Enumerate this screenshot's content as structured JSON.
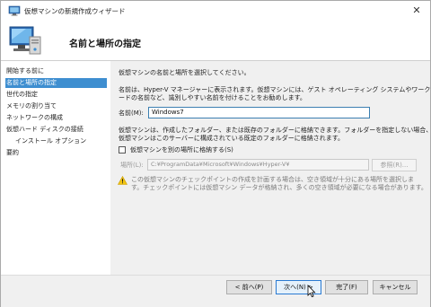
{
  "window": {
    "title": "仮想マシンの新規作成ウィザード",
    "close_glyph": "✕"
  },
  "header": {
    "title": "名前と場所の指定"
  },
  "sidebar": {
    "items": [
      {
        "label": "開始する前に"
      },
      {
        "label": "名前と場所の指定",
        "active": true
      },
      {
        "label": "世代の指定"
      },
      {
        "label": "メモリの割り当て"
      },
      {
        "label": "ネットワークの構成"
      },
      {
        "label": "仮想ハード ディスクの接続"
      },
      {
        "label": "インストール オプション"
      },
      {
        "label": "要約"
      }
    ]
  },
  "content": {
    "intro": "仮想マシンの名前と場所を選択してください。",
    "name_desc_1": "名前は、Hyper-V マネージャーに表示されます。仮想マシンには、ゲスト オペレーティング システムやワークロ",
    "name_desc_2": "ードの名前など、識別しやすい名前を付けることをお勧めします。",
    "name_label": "名前(M):",
    "name_value": "Windows7",
    "folder_desc_1": "仮想マシンは、作成したフォルダー、または既存のフォルダーに格納できます。フォルダーを指定しない場合、",
    "folder_desc_2": "仮想マシンはこのサーバーに構成されている既定のフォルダーに格納されます。",
    "store_checkbox_label": "仮想マシンを別の場所に格納する(S)",
    "store_checked": false,
    "location_label": "場所(L):",
    "location_value": "C:¥ProgramData¥Microsoft¥Windows¥Hyper-V¥",
    "browse_label": "参照(R)...",
    "warning_1": "この仮想マシンのチェックポイントの作成を計画する場合は、空き領域が十分にある場所を選択しま",
    "warning_2": "す。チェックポイントには仮想マシン データが格納され、多くの空き領域が必要になる場合があります。"
  },
  "footer": {
    "prev_label": "< 前へ(P)",
    "next_label": "次へ(N) >",
    "finish_label": "完了(F)",
    "cancel_label": "キャンセル"
  },
  "colors": {
    "accent": "#3e8ed0",
    "warning": "#f2c511",
    "content_bg": "#f0f0f0"
  },
  "icons": {
    "title": "hyper-v-vm-icon",
    "header": "vm-monitor-icon",
    "warning": "warning-icon"
  }
}
